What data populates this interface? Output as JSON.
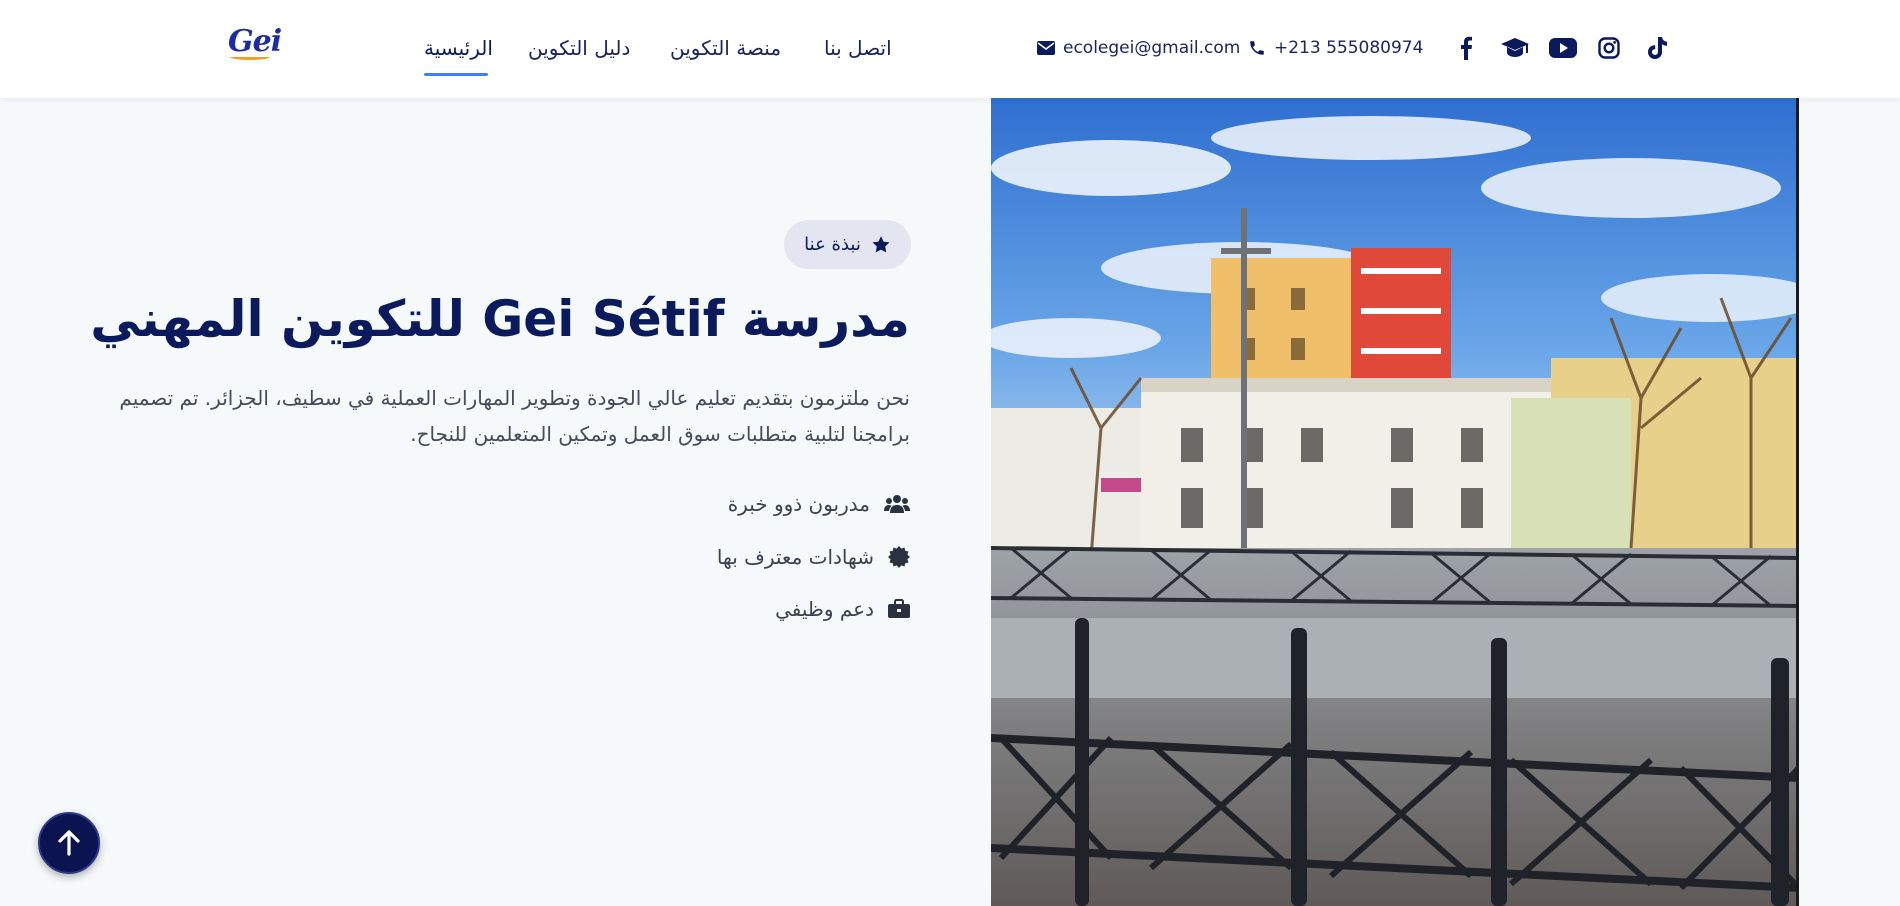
{
  "header": {
    "logo_text": "Gei",
    "nav": {
      "home": "الرئيسية",
      "guide": "دليل التكوين",
      "platform": "منصة التكوين",
      "contact": "اتصل بنا"
    },
    "email": "ecolegei@gmail.com",
    "phone": "+213 555080974",
    "social_icons": [
      "facebook-icon",
      "graduation-cap-icon",
      "youtube-icon",
      "instagram-icon",
      "tiktok-icon"
    ]
  },
  "hero": {
    "badge": "نبذة عنا",
    "title": "مدرسة Gei Sétif للتكوين المهني",
    "description": "نحن ملتزمون بتقديم تعليم عالي الجودة وتطوير المهارات العملية في سطيف، الجزائر. تم تصميم برامجنا لتلبية متطلبات سوق العمل وتمكين المتعلمين للنجاح.",
    "features": {
      "trainers": "مدربون ذوو خبرة",
      "certificates": "شهادات معترف بها",
      "career": "دعم وظيفي"
    }
  },
  "colors": {
    "primary": "#0b1a5c",
    "accent": "#3b82f6",
    "background": "#f5f9fa"
  }
}
